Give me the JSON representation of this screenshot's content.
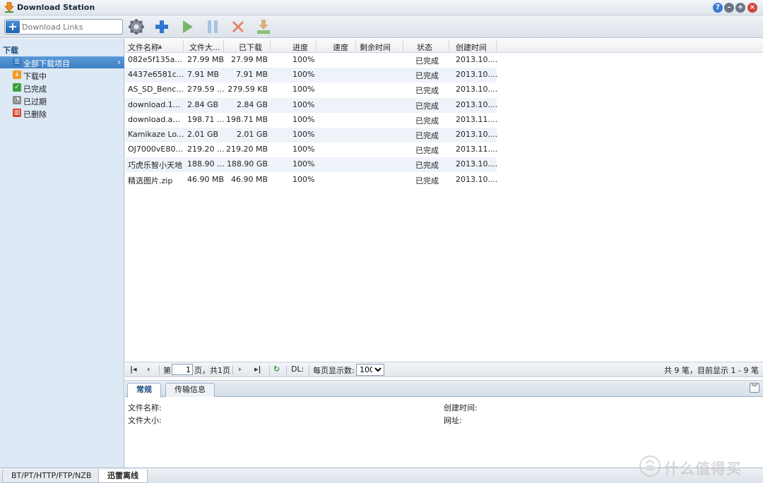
{
  "window": {
    "title": "Download Station"
  },
  "toolbar": {
    "download_links_placeholder": "Download Links",
    "buttons": [
      "settings-icon",
      "add-icon",
      "start-icon",
      "pause-icon",
      "delete-icon",
      "save-icon"
    ]
  },
  "sidebar": {
    "section_title": "下载",
    "items": [
      {
        "label": "全部下载项目",
        "icon": "list-icon",
        "color": "#3a78c2",
        "active": true
      },
      {
        "label": "下载中",
        "icon": "download-arrow-icon",
        "color": "#f29a1d",
        "active": false
      },
      {
        "label": "已完成",
        "icon": "check-icon",
        "color": "#3aa23a",
        "active": false
      },
      {
        "label": "已过期",
        "icon": "clock-icon",
        "color": "#8a8a8a",
        "active": false
      },
      {
        "label": "已删除",
        "icon": "trash-icon",
        "color": "#d9452c",
        "active": false
      }
    ]
  },
  "grid": {
    "columns": [
      "文件名称",
      "文件大...",
      "已下载",
      "进度",
      "速度",
      "剩余时间",
      "状态",
      "创建时间"
    ],
    "sort_indicator": "▲",
    "rows": [
      [
        "082e5f135a...",
        "27.99 MB",
        "27.99 MB",
        "100%",
        "",
        "",
        "已完成",
        "2013.10...."
      ],
      [
        "4437e6581c...",
        "7.91 MB",
        "7.91 MB",
        "100%",
        "",
        "",
        "已完成",
        "2013.10...."
      ],
      [
        "AS_SD_Benc...",
        "279.59 ...",
        "279.59 KB",
        "100%",
        "",
        "",
        "已完成",
        "2013.10...."
      ],
      [
        "download.1...",
        "2.84 GB",
        "2.84 GB",
        "100%",
        "",
        "",
        "已完成",
        "2013.10...."
      ],
      [
        "download.a...",
        "198.71 ...",
        "198.71 MB",
        "100%",
        "",
        "",
        "已完成",
        "2013.11...."
      ],
      [
        "Kamikaze Lo...",
        "2.01 GB",
        "2.01 GB",
        "100%",
        "",
        "",
        "已完成",
        "2013.10...."
      ],
      [
        "OJ7000vE80...",
        "219.20 ...",
        "219.20 MB",
        "100%",
        "",
        "",
        "已完成",
        "2013.11...."
      ],
      [
        "巧虎乐智小天地",
        "188.90 ...",
        "188.90 GB",
        "100%",
        "",
        "",
        "已完成",
        "2013.10...."
      ],
      [
        "精选图片.zip",
        "46.90 MB",
        "46.90 MB",
        "100%",
        "",
        "",
        "已完成",
        "2013.10...."
      ]
    ]
  },
  "pager": {
    "page_prefix": "第",
    "page_value": "1",
    "page_suffix": "页，共1页",
    "dl_label": "DL:",
    "per_page_label": "每页显示数:",
    "per_page_value": "100",
    "summary": "共 9 笔，目前显示 1 - 9 笔"
  },
  "detail": {
    "tabs": [
      "常规",
      "传输信息"
    ],
    "fields": {
      "filename": "文件名称:",
      "filesize": "文件大小:",
      "created": "创建时间:",
      "url": "网址:"
    }
  },
  "bottom_tabs": [
    "BT/PT/HTTP/FTP/NZB",
    "迅雷离线"
  ],
  "watermark": "什么值得买"
}
